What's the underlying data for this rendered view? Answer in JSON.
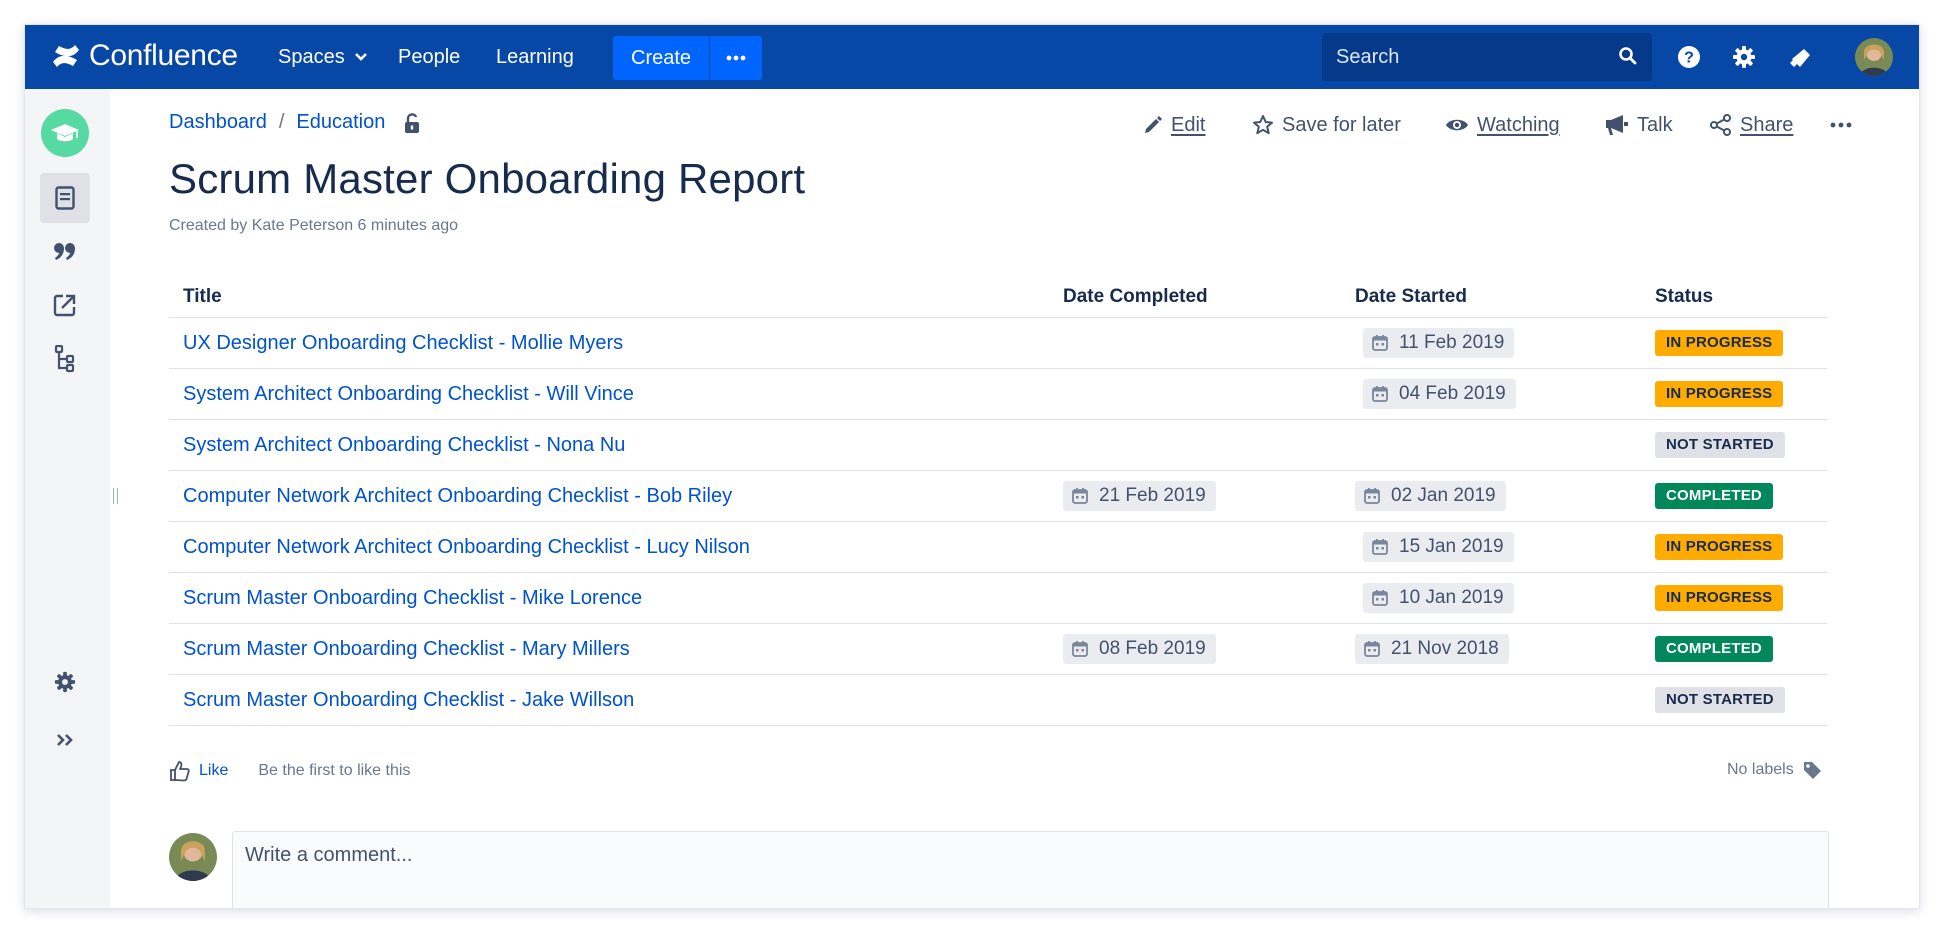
{
  "topnav": {
    "brand": "Confluence",
    "items": [
      {
        "label": "Spaces"
      },
      {
        "label": "People"
      },
      {
        "label": "Learning"
      }
    ],
    "create_label": "Create",
    "search_placeholder": "Search",
    "colors": {
      "bar": "#0747a6",
      "create": "#0065ff"
    }
  },
  "sidebar": {
    "items": [
      {
        "icon": "pages-icon",
        "active": true
      },
      {
        "icon": "blog-quote-icon",
        "active": false
      },
      {
        "icon": "external-link-icon",
        "active": false
      },
      {
        "icon": "page-tree-icon",
        "active": false
      }
    ],
    "bottom": [
      {
        "icon": "space-settings-icon"
      },
      {
        "icon": "expand-sidebar-icon"
      }
    ]
  },
  "breadcrumb": {
    "items": [
      {
        "label": "Dashboard"
      },
      {
        "label": "Education"
      }
    ]
  },
  "page_actions": {
    "edit": "Edit",
    "save_for_later": "Save for later",
    "watching": "Watching",
    "talk": "Talk",
    "share": "Share"
  },
  "page": {
    "title": "Scrum Master Onboarding Report",
    "byline": "Created by Kate Peterson 6 minutes ago"
  },
  "table": {
    "headers": [
      "Title",
      "Date Completed",
      "Date Started",
      "Status"
    ],
    "rows": [
      {
        "title": "UX Designer Onboarding Checklist - Mollie Myers",
        "completed": "",
        "started": "11 Feb 2019",
        "status": "IN PROGRESS"
      },
      {
        "title": "System Architect Onboarding Checklist - Will Vince",
        "completed": "",
        "started": "04 Feb 2019",
        "status": "IN PROGRESS"
      },
      {
        "title": "System Architect Onboarding Checklist - Nona Nu",
        "completed": "",
        "started": "",
        "status": "NOT STARTED"
      },
      {
        "title": "Computer Network Architect Onboarding Checklist - Bob Riley",
        "completed": "21 Feb 2019",
        "started": "02 Jan 2019",
        "status": "COMPLETED"
      },
      {
        "title": "Computer Network Architect Onboarding Checklist - Lucy Nilson",
        "completed": "",
        "started": "15 Jan 2019",
        "status": "IN PROGRESS"
      },
      {
        "title": "Scrum Master Onboarding Checklist - Mike Lorence",
        "completed": "",
        "started": "10 Jan 2019",
        "status": "IN PROGRESS"
      },
      {
        "title": "Scrum Master Onboarding Checklist - Mary Millers",
        "completed": "08 Feb 2019",
        "started": "21 Nov 2018",
        "status": "COMPLETED"
      },
      {
        "title": "Scrum Master Onboarding Checklist - Jake Willson",
        "completed": "",
        "started": "",
        "status": "NOT STARTED"
      }
    ],
    "status_colors": {
      "IN PROGRESS": "#ffab00",
      "NOT STARTED": "#dfe1e6",
      "COMPLETED": "#00875a"
    }
  },
  "footer": {
    "like_label": "Like",
    "like_text": "Be the first to like this",
    "labels_text": "No labels",
    "comment_placeholder": "Write a comment..."
  }
}
